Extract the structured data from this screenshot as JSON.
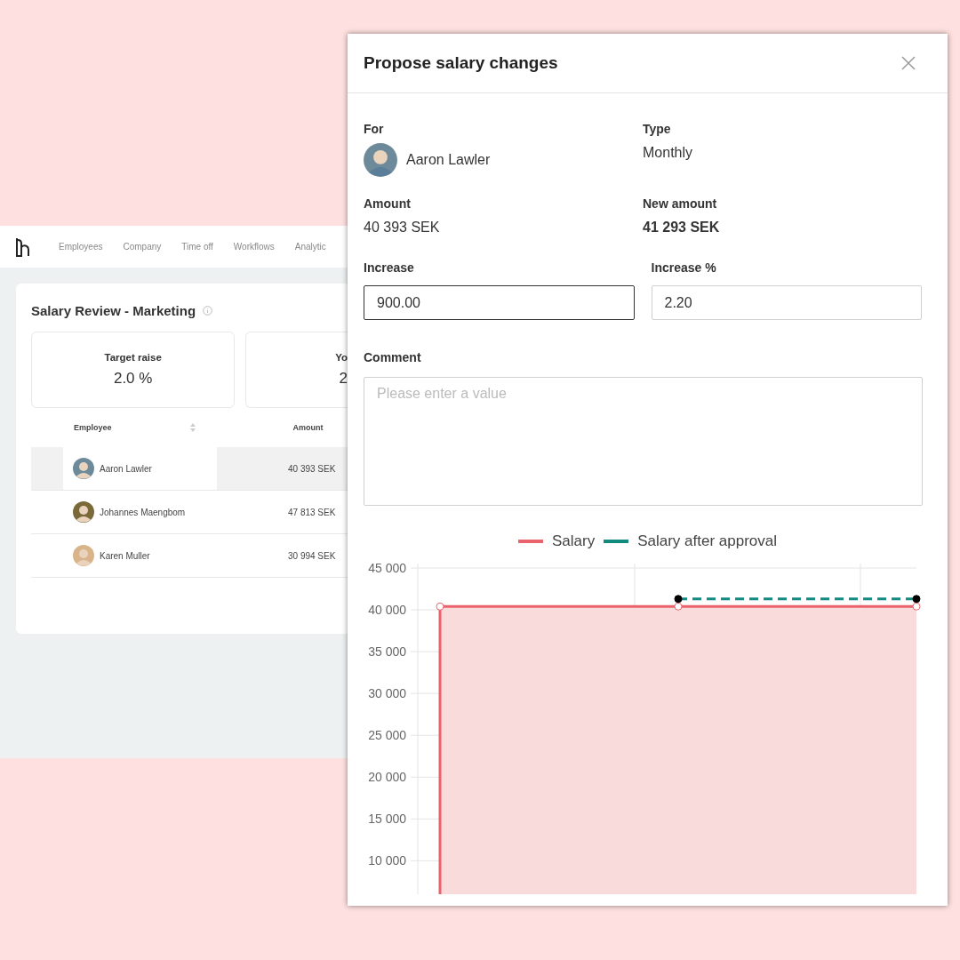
{
  "app": {
    "nav": [
      {
        "label": "Employees"
      },
      {
        "label": "Company"
      },
      {
        "label": "Time off"
      },
      {
        "label": "Workflows"
      },
      {
        "label": "Analytic"
      }
    ],
    "title": "Salary Review - Marketing",
    "stats": [
      {
        "label": "Target raise",
        "value": "2.0 %"
      },
      {
        "label": "Yo",
        "value": "2"
      }
    ],
    "table": {
      "columns": [
        "Employee",
        "Amount"
      ],
      "rows": [
        {
          "name": "Aaron Lawler",
          "amount": "40 393 SEK",
          "selected": true
        },
        {
          "name": "Johannes Maengbom",
          "amount": "47 813 SEK",
          "selected": false
        },
        {
          "name": "Karen Muller",
          "amount": "30 994 SEK",
          "selected": false
        }
      ]
    }
  },
  "dialog": {
    "title": "Propose salary changes",
    "for": {
      "label": "For",
      "value": "Aaron Lawler"
    },
    "type": {
      "label": "Type",
      "value": "Monthly"
    },
    "amount": {
      "label": "Amount",
      "value": "40 393 SEK"
    },
    "new_amount": {
      "label": "New amount",
      "value": "41 293 SEK"
    },
    "increase": {
      "label": "Increase",
      "value": "900.00",
      "focused": true
    },
    "increase_pct": {
      "label": "Increase %",
      "value": "2.20",
      "focused": false
    },
    "comment": {
      "label": "Comment",
      "placeholder": "Please enter a value"
    },
    "chart_data": {
      "type": "line",
      "legend": "top",
      "grid": true,
      "ylim": [
        6000,
        45000
      ],
      "yticks": [
        {
          "value": 10000,
          "label": "10 000"
        },
        {
          "value": 15000,
          "label": "15 000"
        },
        {
          "value": 20000,
          "label": "20 000"
        },
        {
          "value": 25000,
          "label": "25 000"
        },
        {
          "value": 30000,
          "label": "30 000"
        },
        {
          "value": 35000,
          "label": "35 000"
        },
        {
          "value": 40000,
          "label": "40 000"
        },
        {
          "value": 45000,
          "label": "45 000"
        }
      ],
      "series": [
        {
          "name": "Salary",
          "color": "#e8636b",
          "line_style": "solid",
          "marker": "circle",
          "values": [
            40400,
            40400,
            40400
          ]
        },
        {
          "name": "Salary after approval",
          "color": "#138a80",
          "line_style": "dashed",
          "marker": "circle",
          "values": [
            null,
            41300,
            41300
          ]
        }
      ]
    }
  }
}
